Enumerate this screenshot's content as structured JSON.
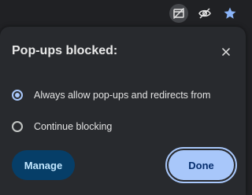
{
  "toolbar": {
    "icons": [
      "popup-blocked-icon",
      "eye-off-icon",
      "star-icon"
    ],
    "star_color": "#8ab4f8"
  },
  "dialog": {
    "title": "Pop-ups blocked:",
    "close_icon": "close-icon",
    "options": [
      {
        "label": "Always allow pop-ups and redirects from",
        "checked": true
      },
      {
        "label": "Continue blocking",
        "checked": false
      }
    ],
    "manage_label": "Manage",
    "done_label": "Done"
  },
  "colors": {
    "accent": "#a8c7fa",
    "manage_bg": "#063e68",
    "dialog_bg": "#282a2e"
  }
}
